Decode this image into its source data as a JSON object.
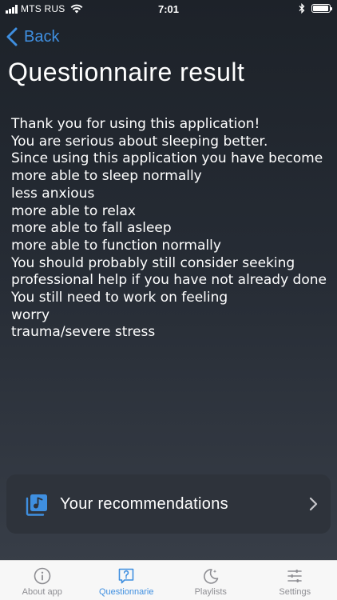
{
  "status_bar": {
    "carrier": "MTS RUS",
    "time": "7:01",
    "battery_level": 0.95
  },
  "nav": {
    "back_label": "Back"
  },
  "page_title": "Questionnaire result",
  "result_lines": [
    "Thank you for using this application!",
    "You are serious about sleeping better.",
    "Since using this application you have become",
    "more able to sleep normally",
    "less anxious",
    "more able to relax",
    "more able to fall asleep",
    "more able to function normally",
    "You should probably still consider seeking professional help if you have not already done",
    "You still need to work on feeling",
    "worry",
    "trauma/severe stress"
  ],
  "recommendations": {
    "label": "Your recommendations",
    "icon": "music-playlist-icon"
  },
  "tabs": [
    {
      "label": "About app",
      "icon": "info-icon",
      "active": false
    },
    {
      "label": "Questionnarie",
      "icon": "question-bubble-icon",
      "active": true
    },
    {
      "label": "Playlists",
      "icon": "moon-icon",
      "active": false
    },
    {
      "label": "Settings",
      "icon": "sliders-icon",
      "active": false
    }
  ],
  "colors": {
    "accent": "#3f8fe0",
    "inactive_tab": "#8e8e93",
    "card_bg": "#2e333b"
  }
}
